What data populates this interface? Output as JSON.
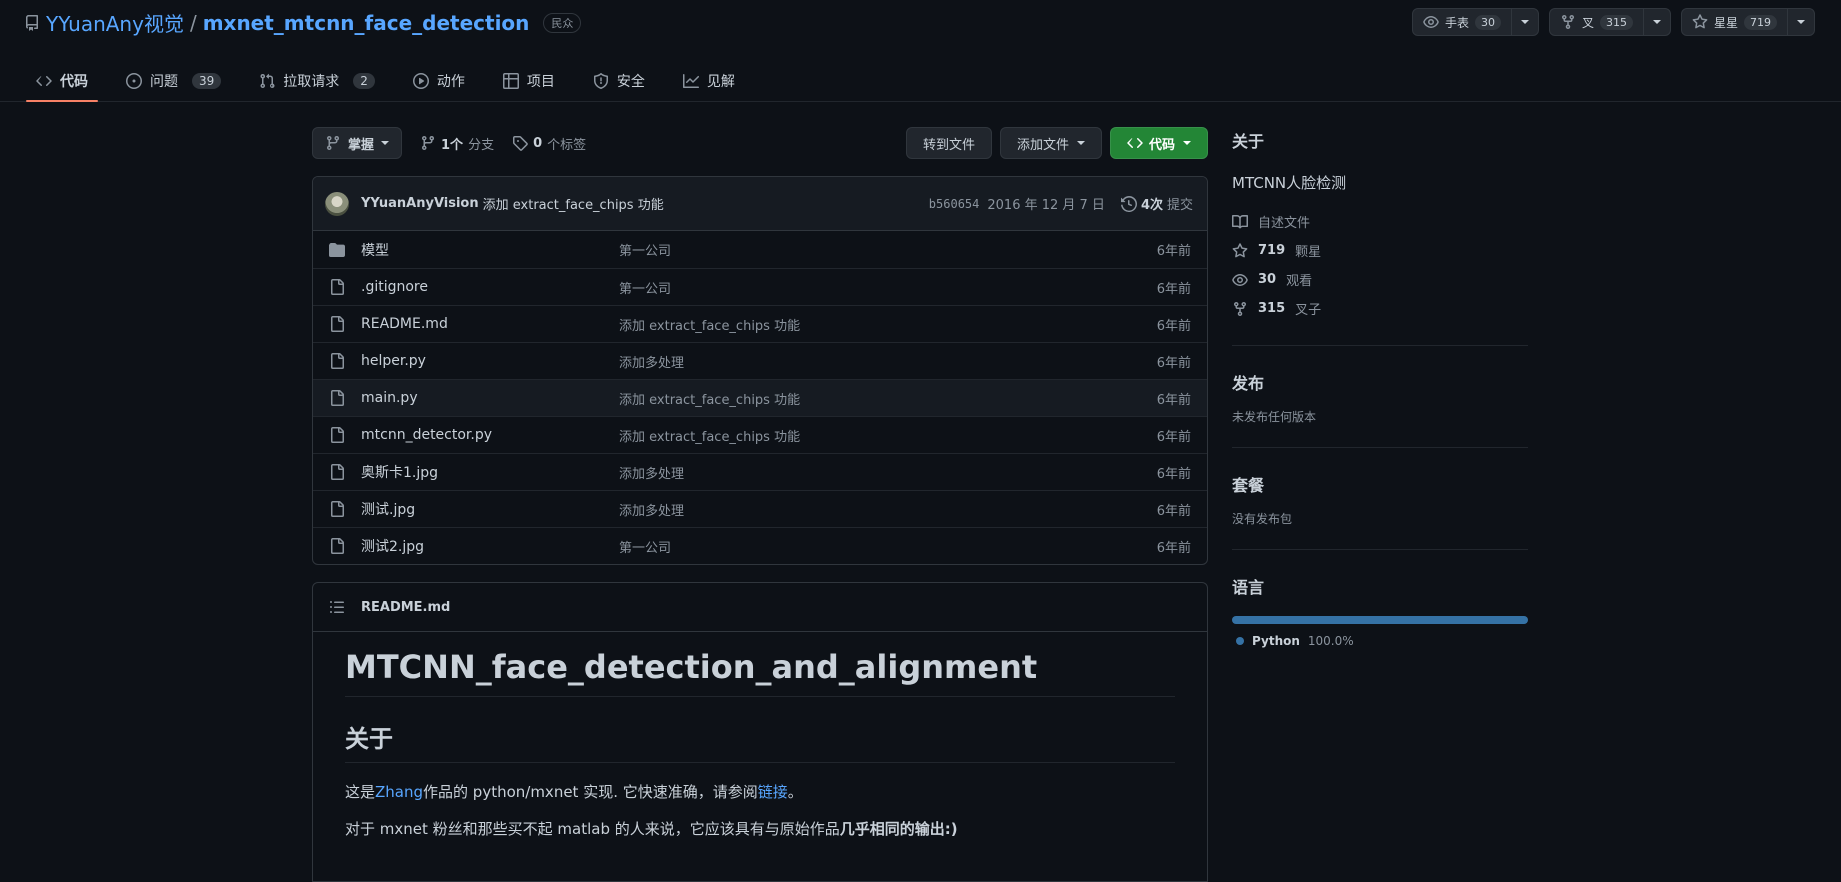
{
  "repo": {
    "owner": "YYuanAny视觉",
    "separator": "/",
    "name": "mxnet_mtcnn_face_detection",
    "visibility": "民众"
  },
  "actions": {
    "watch": {
      "label": "手表",
      "count": "30"
    },
    "fork": {
      "label": "叉",
      "count": "315"
    },
    "star": {
      "label": "星星",
      "count": "719"
    }
  },
  "tabs": [
    {
      "label": "代码",
      "count": "",
      "icon": "code-icon"
    },
    {
      "label": "问题",
      "count": "39",
      "icon": "issue-icon"
    },
    {
      "label": "拉取请求",
      "count": "2",
      "icon": "pull-request-icon"
    },
    {
      "label": "动作",
      "count": "",
      "icon": "play-icon"
    },
    {
      "label": "项目",
      "count": "",
      "icon": "table-icon"
    },
    {
      "label": "安全",
      "count": "",
      "icon": "shield-icon"
    },
    {
      "label": "见解",
      "count": "",
      "icon": "graph-icon"
    }
  ],
  "toolbar": {
    "branch": "掌握",
    "branches_count": "1个",
    "branches_label": "分支",
    "tags_count": "0",
    "tags_label": "个标签",
    "goto_file": "转到文件",
    "add_file": "添加文件",
    "code": "代码"
  },
  "commit": {
    "author": "YYuanAnyVision",
    "message": "添加 extract_face_chips 功能",
    "sha": "b560654",
    "date": "2016 年 12 月 7 日",
    "count": "4次",
    "count_label": "提交"
  },
  "files": [
    {
      "name": "模型",
      "type": "folder",
      "message": "第一公司",
      "age": "6年前"
    },
    {
      "name": ".gitignore",
      "type": "file",
      "message": "第一公司",
      "age": "6年前"
    },
    {
      "name": "README.md",
      "type": "file",
      "message": "添加 extract_face_chips 功能",
      "age": "6年前"
    },
    {
      "name": "helper.py",
      "type": "file",
      "message": "添加多处理",
      "age": "6年前"
    },
    {
      "name": "main.py",
      "type": "file",
      "message": "添加 extract_face_chips 功能",
      "age": "6年前"
    },
    {
      "name": "mtcnn_detector.py",
      "type": "file",
      "message": "添加 extract_face_chips 功能",
      "age": "6年前"
    },
    {
      "name": "奥斯卡1.jpg",
      "type": "file",
      "message": "添加多处理",
      "age": "6年前"
    },
    {
      "name": "测试.jpg",
      "type": "file",
      "message": "添加多处理",
      "age": "6年前"
    },
    {
      "name": "测试2.jpg",
      "type": "file",
      "message": "第一公司",
      "age": "6年前"
    }
  ],
  "readme": {
    "filename": "README.md",
    "h1": "MTCNN_face_detection_and_alignment",
    "h2": "关于",
    "p1_prefix": "这是",
    "p1_link1": "Zhang",
    "p1_mid": "作品的 python/mxnet 实现. 它快速准确，请参阅",
    "p1_link2": "链接",
    "p1_suffix": "。",
    "p2_prefix": "对于 mxnet 粉丝和那些买不起 matlab 的人来说，它应该具有与原始作品",
    "p2_bold": "几乎相同的输出:)"
  },
  "sidebar": {
    "about_title": "关于",
    "description": "MTCNN人脸检测",
    "readme_label": "自述文件",
    "stars_count": "719",
    "stars_label": "颗星",
    "watching_count": "30",
    "watching_label": "观看",
    "forks_count": "315",
    "forks_label": "叉子",
    "releases_title": "发布",
    "releases_text": "未发布任何版本",
    "packages_title": "套餐",
    "packages_text": "没有发布包",
    "languages_title": "语言",
    "languages": [
      {
        "name": "Python",
        "percent": "100.0%",
        "color": "#3572A5"
      }
    ]
  },
  "colors": {
    "accent": "#58a6ff",
    "tab_underline": "#f78166",
    "primary_button": "#238636"
  }
}
